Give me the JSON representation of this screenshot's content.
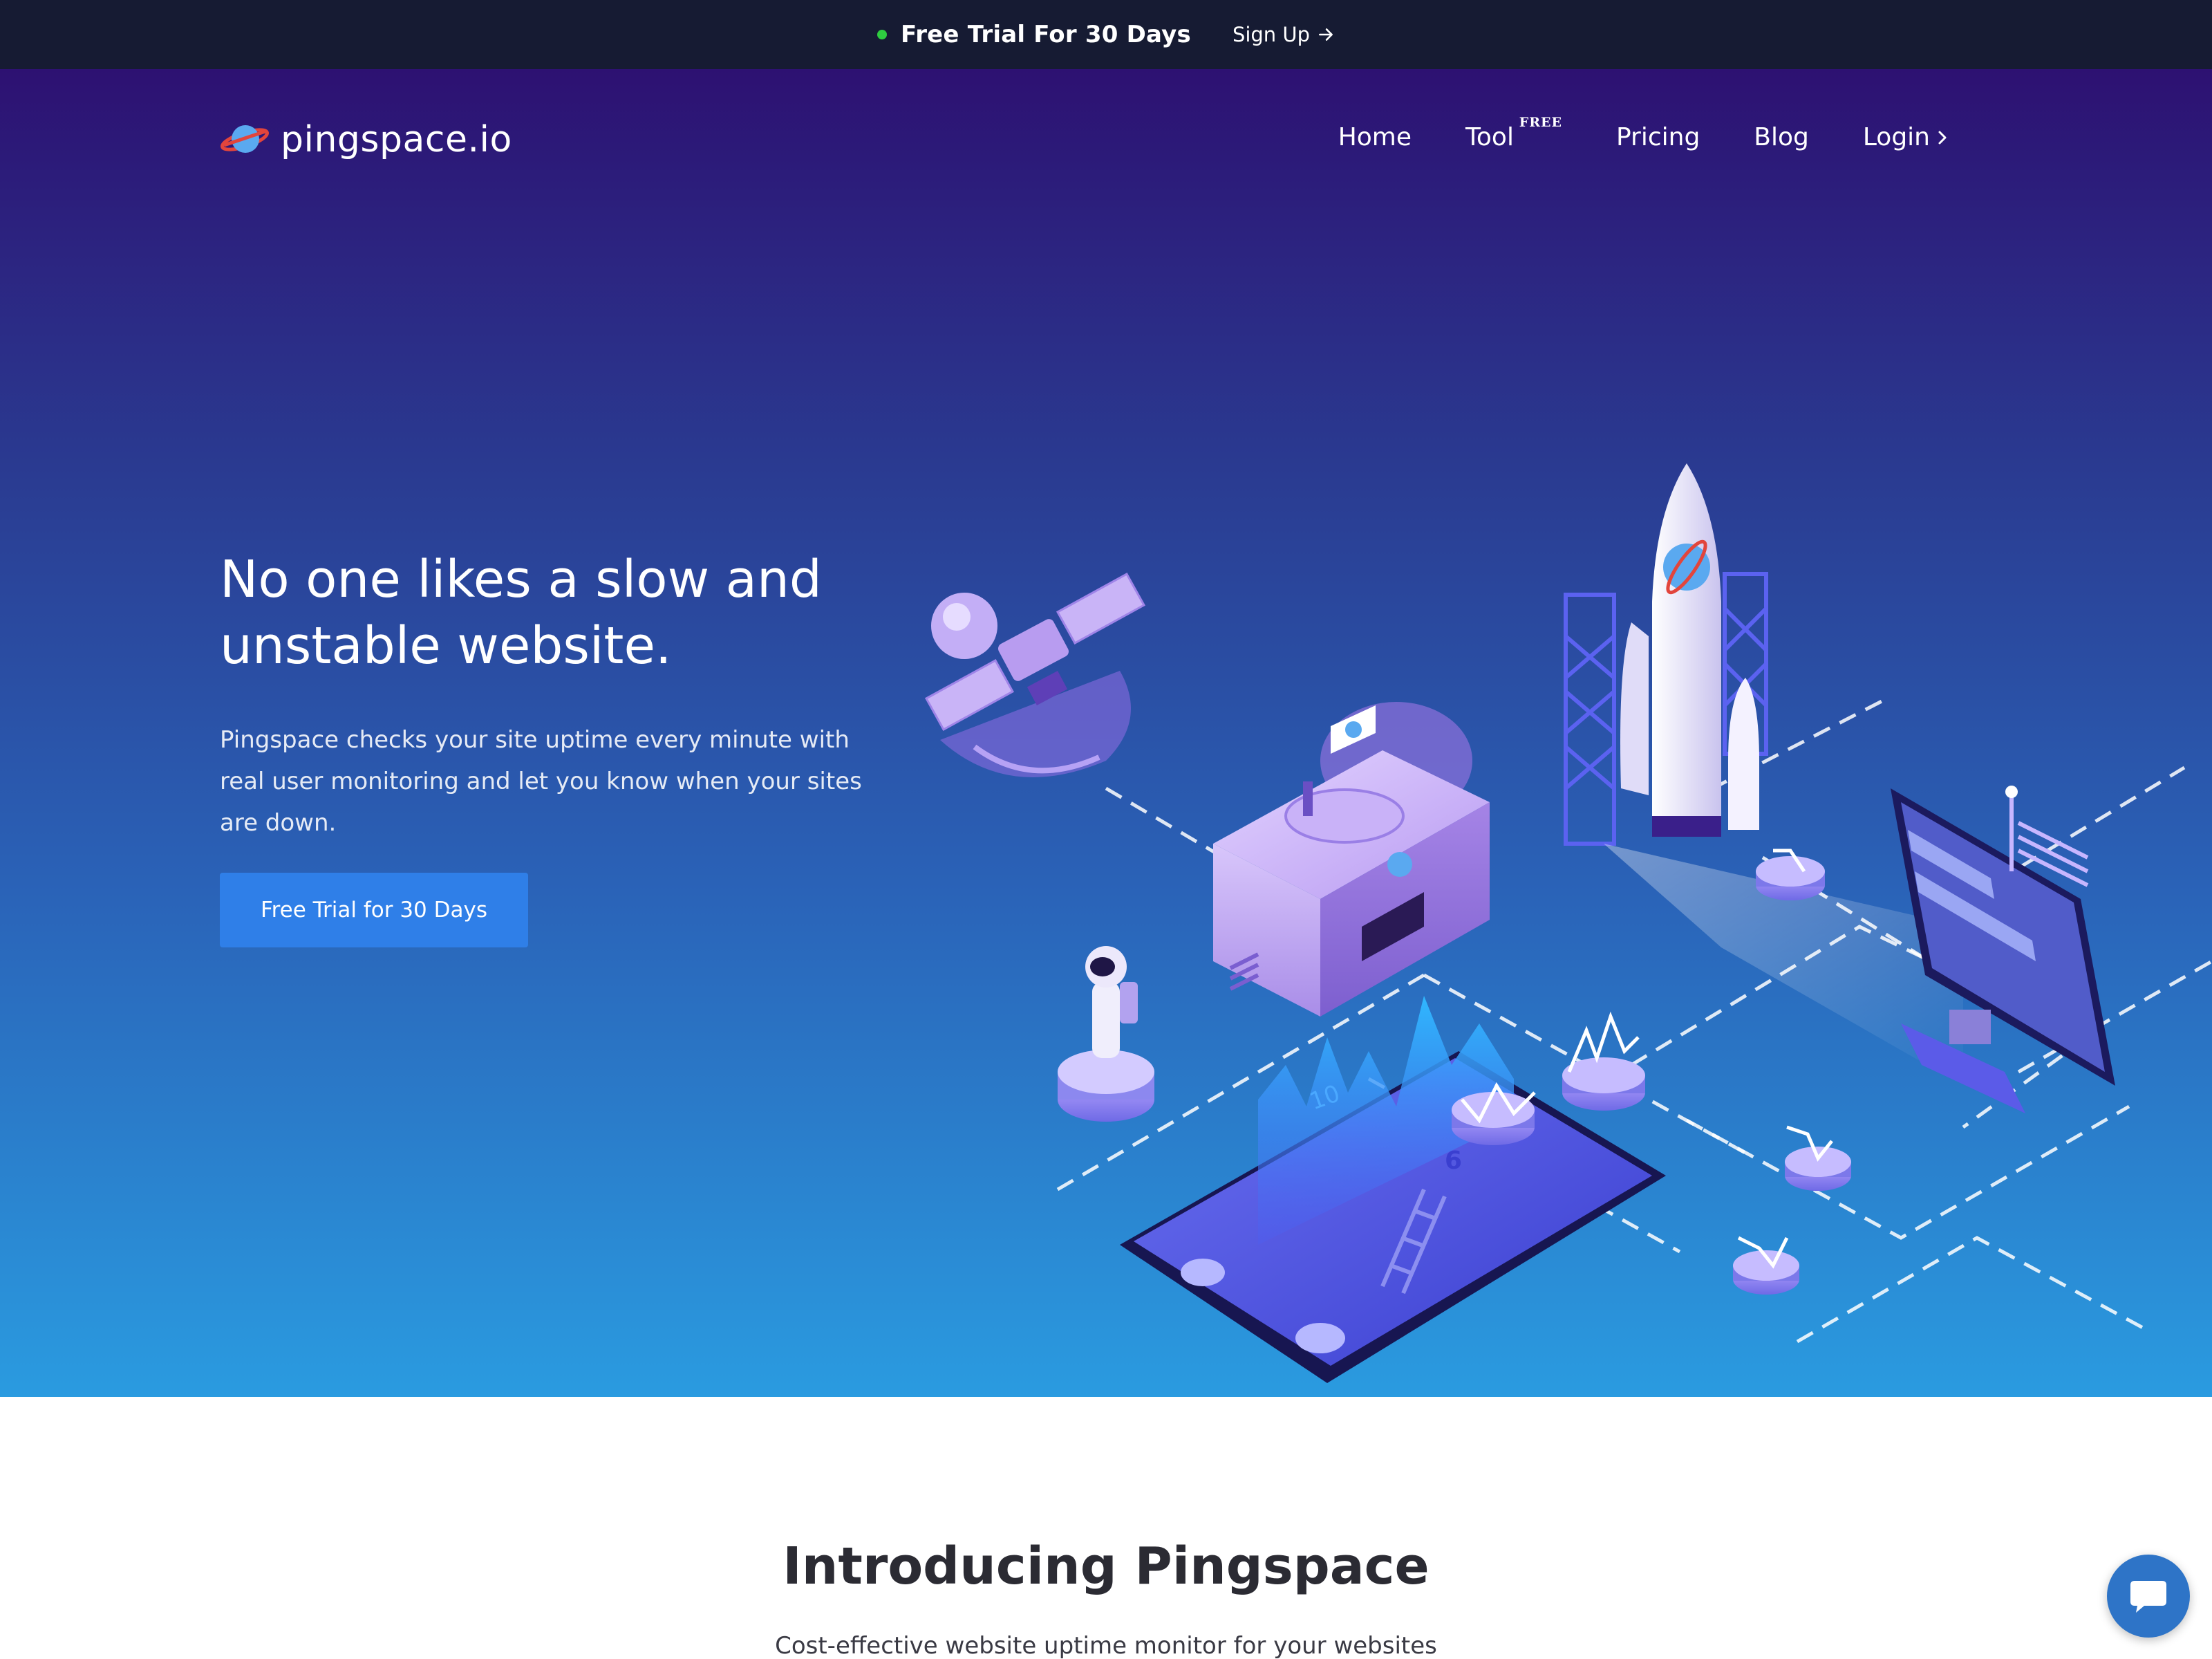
{
  "topbar": {
    "promo_text": "Free Trial For 30 Days",
    "signup_label": "Sign Up",
    "status_color": "#2ecc40"
  },
  "header": {
    "logo_text": "pingspace.io",
    "nav": {
      "home": "Home",
      "tool": "Tool",
      "tool_badge": "FREE",
      "pricing": "Pricing",
      "blog": "Blog",
      "login": "Login"
    }
  },
  "hero": {
    "headline": "No one likes a slow and unstable website.",
    "description": "Pingspace checks your site uptime every minute with real user monitoring and let you know when your sites are down.",
    "cta_label": "Free Trial for 30 Days",
    "illustration_numbers": [
      "10",
      "6"
    ]
  },
  "intro": {
    "title": "Introducing Pingspace",
    "subtitle": "Cost-effective website uptime monitor for your websites"
  },
  "colors": {
    "topbar_bg": "#161b33",
    "hero_top": "#2d1172",
    "hero_bottom": "#2a9be0",
    "cta_bg": "#2f7fe8",
    "chat_bg": "#2e74c7"
  }
}
